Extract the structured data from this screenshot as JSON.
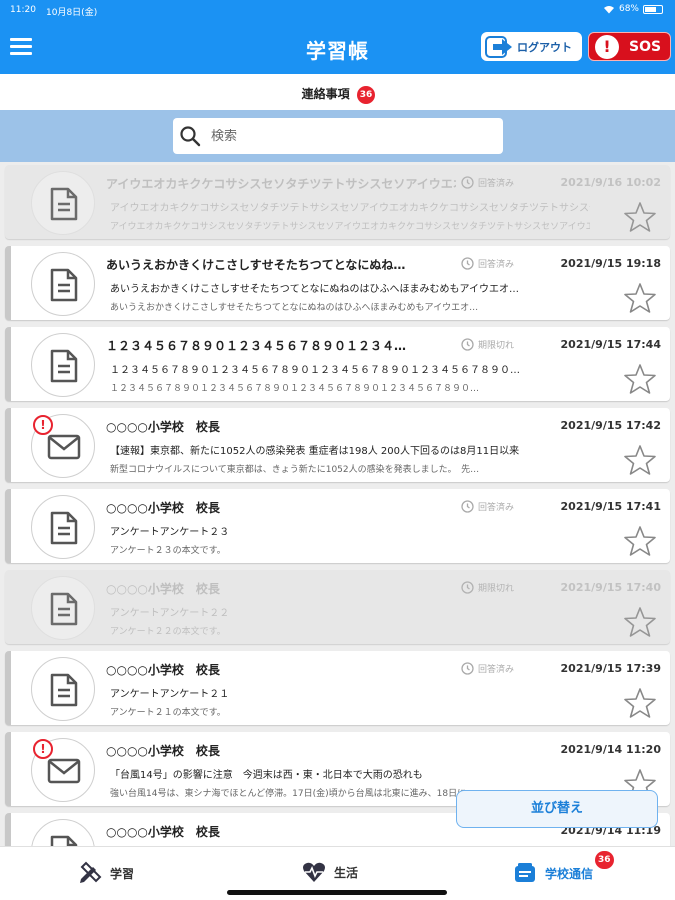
{
  "status_bar": {
    "time": "11:20",
    "date": "10月8日(金)",
    "battery": "68%",
    "battery_level": 0.68
  },
  "header": {
    "title": "学習帳",
    "logout_label": "ログアウト",
    "sos_label": "SOS",
    "sos_icon": "!"
  },
  "section": {
    "label": "連絡事項",
    "badge": "36"
  },
  "search": {
    "placeholder": "検索",
    "value": ""
  },
  "items": [
    {
      "title": "アイウエオカキクケコサシスセソタチツテトサシスセソアイウエオカキクケコサシスセソタチツテトサシスセソアイウエオカキクケコ",
      "line1": "アイウエオカキクケコサシスセソタチツテトサシスセソアイウエオカキクケコサシスセソタチツテトサシスセソアイウエオカキクケコ",
      "line2": "アイウエオカキクケコサシスセソタチツテトサシスセソアイウエオカキクケコサシスセソタチツテトサシスセソアイウエオカキクケコ",
      "status": "回答済み",
      "date": "2021/9/16 10:02",
      "icon": "document-icon",
      "dim": true,
      "alert": false
    },
    {
      "title": "あいうえおかきくけこさしすせそたちつてとなにぬね…",
      "line1": "あいうえおかきくけこさしすせそたちつてとなにぬねのはひふへほまみむめもアイウエオ…",
      "line2": "あいうえおかきくけこさしすせそたちつてとなにぬねのはひふへほまみむめもアイウエオ…",
      "status": "回答済み",
      "date": "2021/9/15 19:18",
      "icon": "document-icon",
      "dim": false,
      "alert": false
    },
    {
      "title": "１２３４５６７８９０１２３４５６７８９０１２３４…",
      "line1": "１２３４５６７８９０１２３４５６７８９０１２３４５６７８９０１２３４５６７８９０…",
      "line2": "１２３４５６７８９０１２３４５６７８９０１２３４５６７８９０１２３４５６７８９０…",
      "status": "期限切れ",
      "date": "2021/9/15 17:44",
      "icon": "document-icon",
      "dim": false,
      "alert": false
    },
    {
      "title": "○○○○小学校　校長",
      "line1": "【速報】東京都、新たに1052人の感染発表 重症者は198人 200人下回るのは8月11日以来",
      "line2": "新型コロナウイルスについて東京都は、きょう新たに1052人の感染を発表しました。　先…",
      "status": "",
      "date": "2021/9/15 17:42",
      "icon": "mail-icon",
      "dim": false,
      "alert": true
    },
    {
      "title": "○○○○小学校　校長",
      "line1": "アンケートアンケート２３",
      "line2": "アンケート２３の本文です。",
      "status": "回答済み",
      "date": "2021/9/15 17:41",
      "icon": "document-icon",
      "dim": false,
      "alert": false
    },
    {
      "title": "○○○○小学校　校長",
      "line1": "アンケートアンケート２２",
      "line2": "アンケート２２の本文です。",
      "status": "期限切れ",
      "date": "2021/9/15 17:40",
      "icon": "document-icon",
      "dim": true,
      "alert": false
    },
    {
      "title": "○○○○小学校　校長",
      "line1": "アンケートアンケート２１",
      "line2": "アンケート２１の本文です。",
      "status": "回答済み",
      "date": "2021/9/15 17:39",
      "icon": "document-icon",
      "dim": false,
      "alert": false
    },
    {
      "title": "○○○○小学校　校長",
      "line1": "「台風14号」の影響に注意　今週末は西・東・北日本で大雨の恐れも",
      "line2": "強い台風14号は、東シナ海でほとんど停滞。17日(金)頃から台風は北東に進み、18日に…",
      "status": "",
      "date": "2021/9/14 11:20",
      "icon": "mail-icon",
      "dim": false,
      "alert": true
    },
    {
      "title": "○○○○小学校　校長",
      "line1": "",
      "line2": "",
      "status": "",
      "date": "2021/9/14 11:19",
      "icon": "document-icon",
      "dim": false,
      "alert": false
    }
  ],
  "sort_label": "並び替え",
  "tabs": [
    {
      "label": "学習",
      "icon": "pencil-ruler-icon"
    },
    {
      "label": "生活",
      "icon": "heart-pulse-icon"
    },
    {
      "label": "学校通信",
      "icon": "school-notice-icon",
      "badge": "36"
    }
  ],
  "colors": {
    "primary": "#1b92f3",
    "sos": "#d8101d",
    "badge": "#e8232f",
    "search_bg": "#9cc2e8"
  }
}
